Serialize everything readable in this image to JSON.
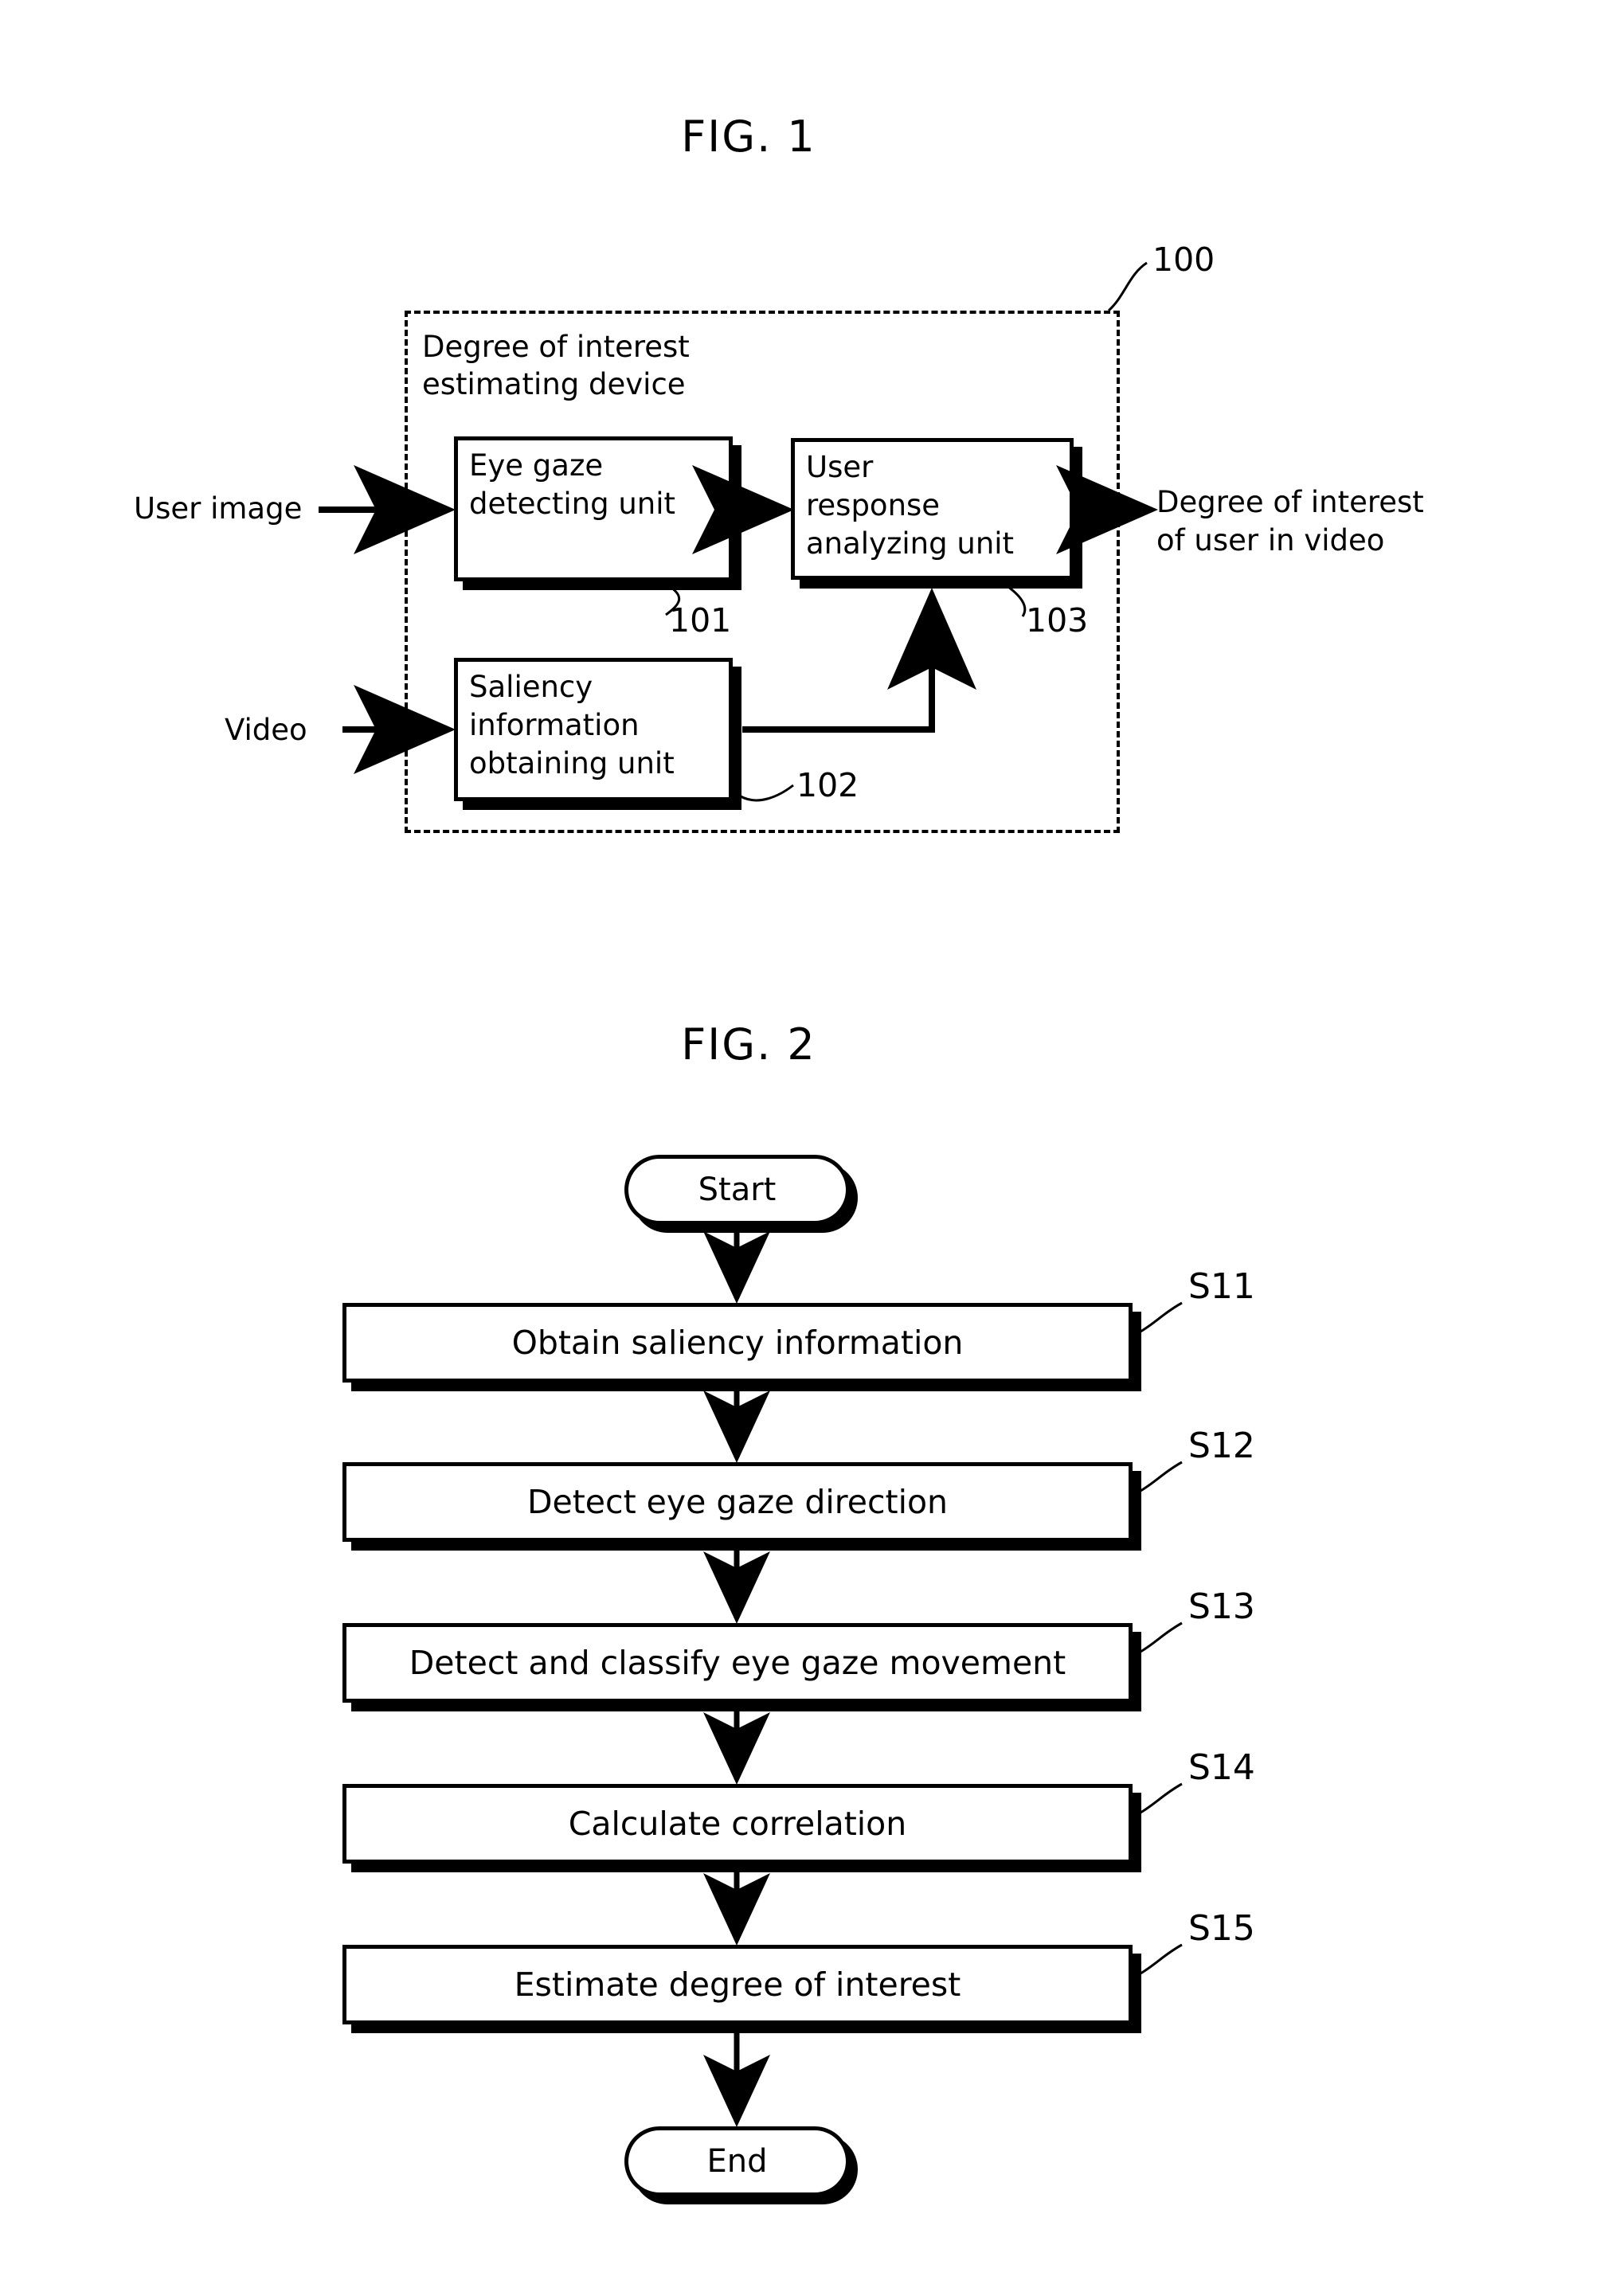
{
  "figures": [
    {
      "title": "FIG. 1",
      "type": "block-diagram",
      "device": {
        "reference": "100",
        "caption": "Degree of interest\nestimating device"
      },
      "inputs": [
        {
          "label": "User image"
        },
        {
          "label": "Video"
        }
      ],
      "outputs": [
        {
          "label": "Degree of interest\nof user in video"
        }
      ],
      "blocks": [
        {
          "reference": "101",
          "label": "Eye gaze\ndetecting unit"
        },
        {
          "reference": "102",
          "label": "Saliency\ninformation\nobtaining unit"
        },
        {
          "reference": "103",
          "label": "User\nresponse\nanalyzing unit"
        }
      ]
    },
    {
      "title": "FIG. 2",
      "type": "flowchart",
      "start_label": "Start",
      "end_label": "End",
      "steps": [
        {
          "reference": "S11",
          "label": "Obtain saliency information"
        },
        {
          "reference": "S12",
          "label": "Detect eye gaze direction"
        },
        {
          "reference": "S13",
          "label": "Detect and classify eye gaze movement"
        },
        {
          "reference": "S14",
          "label": "Calculate correlation"
        },
        {
          "reference": "S15",
          "label": "Estimate degree of interest"
        }
      ]
    }
  ],
  "colors": {
    "ink": "#000000",
    "paper": "#ffffff"
  }
}
